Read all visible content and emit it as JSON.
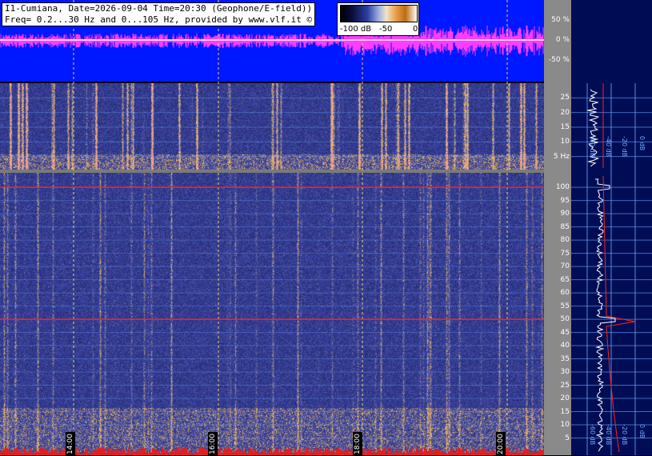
{
  "header": {
    "line1": "I1-Cumiana, Date=2026-09-04 Time=20:30 (Geophone/E-field))",
    "line2": "Freq= 0.2...30 Hz and 0...105 Hz, provided by www.vlf.it ©"
  },
  "colorbar": {
    "labels": [
      "-100 dB",
      "-50",
      "0"
    ]
  },
  "colors": {
    "wave_bg": "#0018ff",
    "wave_trace": "#ff3cff",
    "side_bg": "#000d55",
    "label_bg": "#8a8a8a",
    "grid": "#6fa8ff",
    "marker": "#ff2020"
  },
  "chart_data": [
    {
      "type": "line",
      "name": "waveform",
      "yticks": [
        "50 %",
        "0 %",
        "-50 %"
      ],
      "ylim": [
        -100,
        100
      ]
    },
    {
      "type": "heatmap",
      "name": "spectrogram-low",
      "ylabel": "Hz",
      "yticks": [
        25,
        20,
        15,
        10,
        5
      ],
      "ylim": [
        0,
        30
      ],
      "xticks": [
        "14:00",
        "16:00",
        "18:00",
        "20:00"
      ]
    },
    {
      "type": "heatmap",
      "name": "spectrogram-high",
      "yticks": [
        100,
        95,
        90,
        85,
        80,
        75,
        70,
        65,
        60,
        55,
        50,
        45,
        40,
        35,
        30,
        25,
        20,
        15,
        10,
        5
      ],
      "ylim": [
        0,
        105
      ],
      "xticks": [
        "14:00",
        "16:00",
        "18:00",
        "20:00"
      ],
      "markers_hz": [
        100,
        50
      ]
    },
    {
      "type": "line",
      "name": "spectrum-side",
      "xticks": [
        "-60 dB",
        "-40 dB",
        "-20 dB",
        "0 dB"
      ]
    }
  ]
}
